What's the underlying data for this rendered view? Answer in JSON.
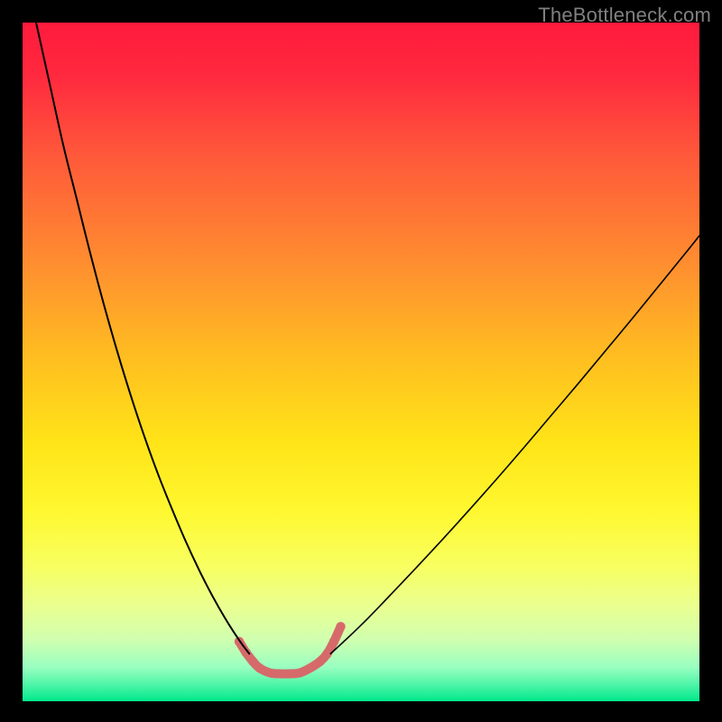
{
  "watermark": "TheBottleneck.com",
  "chart_data": {
    "type": "line",
    "title": "",
    "xlabel": "",
    "ylabel": "",
    "xlim": [
      0,
      100
    ],
    "ylim": [
      0,
      100
    ],
    "background_gradient": {
      "stops": [
        {
          "offset": 0.0,
          "color": "#ff1a3c"
        },
        {
          "offset": 0.08,
          "color": "#ff2a3f"
        },
        {
          "offset": 0.2,
          "color": "#ff5a3a"
        },
        {
          "offset": 0.35,
          "color": "#ff8c30"
        },
        {
          "offset": 0.5,
          "color": "#ffc020"
        },
        {
          "offset": 0.62,
          "color": "#ffe418"
        },
        {
          "offset": 0.72,
          "color": "#fff830"
        },
        {
          "offset": 0.8,
          "color": "#f8ff60"
        },
        {
          "offset": 0.86,
          "color": "#eaff90"
        },
        {
          "offset": 0.91,
          "color": "#d0ffb0"
        },
        {
          "offset": 0.95,
          "color": "#98ffc0"
        },
        {
          "offset": 0.975,
          "color": "#50f5a8"
        },
        {
          "offset": 1.0,
          "color": "#00e88c"
        }
      ]
    },
    "series": [
      {
        "name": "left-curve",
        "color": "#000000",
        "width": 2.0,
        "x": [
          2,
          4,
          6,
          8,
          10,
          12,
          14,
          16,
          18,
          20,
          22,
          24,
          26,
          28,
          30,
          32,
          33.5
        ],
        "y": [
          100,
          91,
          82,
          74,
          66,
          58.5,
          51.5,
          45,
          39,
          33.5,
          28.5,
          23.8,
          19.5,
          15.6,
          12.1,
          9.0,
          7.0
        ]
      },
      {
        "name": "right-curve",
        "color": "#000000",
        "width": 1.6,
        "x": [
          45.5,
          48,
          51,
          54,
          58,
          62,
          66,
          70,
          74,
          78,
          82,
          86,
          90,
          94,
          98,
          100
        ],
        "y": [
          7.0,
          9.3,
          12.2,
          15.3,
          19.5,
          23.8,
          28.2,
          32.7,
          37.3,
          42.0,
          46.7,
          51.5,
          56.3,
          61.2,
          66.1,
          68.6
        ]
      },
      {
        "name": "valley-highlight",
        "color": "#d66a6a",
        "width": 10,
        "cap": "round",
        "x": [
          32.0,
          33.0,
          34.0,
          35.0,
          36.5,
          38.0,
          39.5,
          41.0,
          42.5,
          44.0,
          45.0,
          46.0,
          47.0
        ],
        "y": [
          8.8,
          7.2,
          5.9,
          4.9,
          4.2,
          4.05,
          4.05,
          4.2,
          4.9,
          5.9,
          7.0,
          8.8,
          11.0
        ]
      }
    ],
    "dotted_overlay": {
      "on_series": "valley-highlight",
      "color": "#d66a6a",
      "radius": 5.2,
      "x": [
        32.0,
        33.0,
        34.0,
        35.0,
        44.0,
        45.0,
        46.0,
        47.0
      ],
      "y": [
        8.8,
        7.2,
        5.9,
        4.9,
        5.9,
        7.0,
        8.8,
        11.0
      ]
    }
  }
}
